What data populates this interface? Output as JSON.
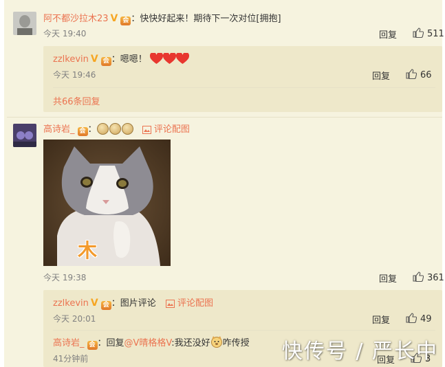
{
  "comments": [
    {
      "user": "阿不都沙拉木23",
      "verified_mark": "V",
      "text": "：快快好起来！期待下一次对位[拥抱]",
      "time": "今天 19:40",
      "reply_label": "回复",
      "likes": "511",
      "sub_replies": [
        {
          "user": "zzlkevin",
          "verified_mark": "V",
          "text": "：嗯嗯！",
          "emoji": [
            "heart",
            "heart",
            "heart"
          ],
          "time": "今天 19:46",
          "reply_label": "回复",
          "likes": "66"
        }
      ],
      "more_replies": "共66条回复"
    },
    {
      "user": "高诗岩_",
      "text": "：",
      "emoji": [
        "face",
        "face",
        "face"
      ],
      "pic_label": "评论配图",
      "image_caption": "木",
      "time": "今天 19:38",
      "reply_label": "回复",
      "likes": "361",
      "sub_replies": [
        {
          "user": "zzlkevin",
          "verified_mark": "V",
          "text": "：图片评论",
          "pic_label": "评论配图",
          "time": "今天 20:01",
          "reply_label": "回复",
          "likes": "49"
        },
        {
          "user": "高诗岩_",
          "text_prefix": "：回复",
          "mention": "@V晴格格V",
          "text_suffix": ":我还没好",
          "text_end": "咋传授",
          "time": "41分钟前",
          "reply_label": "回复",
          "likes": "3"
        }
      ]
    }
  ],
  "watermark": "快传号 / 严长中",
  "colors": {
    "accent": "#eb7350",
    "background": "#f6f3df",
    "sub_background": "#eee8ca",
    "vip": "#f6a623"
  }
}
